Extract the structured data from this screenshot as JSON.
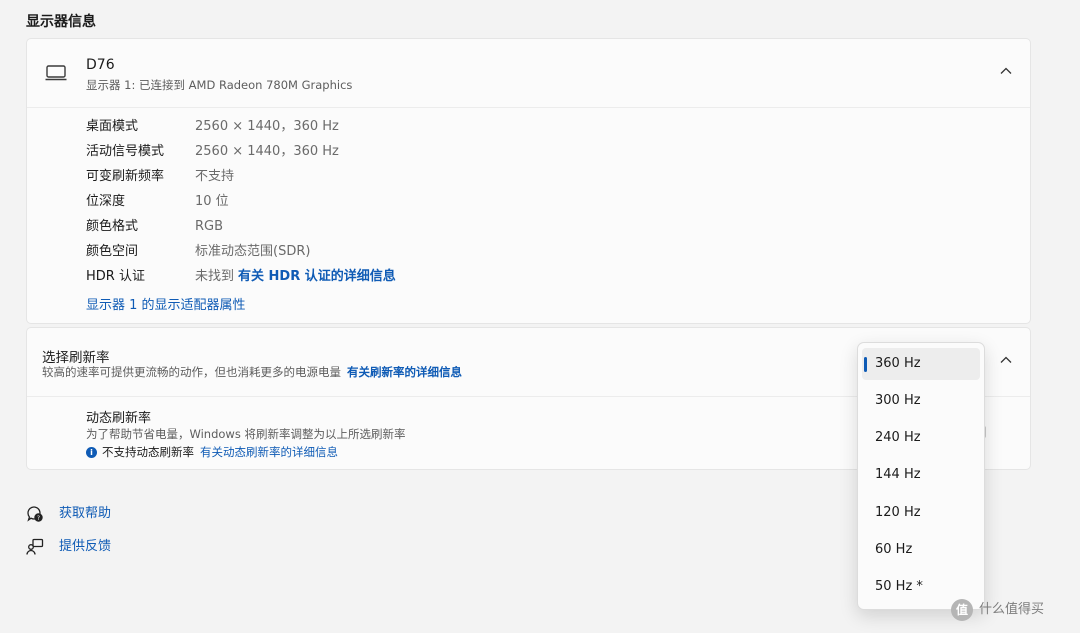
{
  "page": {
    "section_title": "显示器信息"
  },
  "display": {
    "name": "D76",
    "subtitle": "显示器 1: 已连接到 AMD Radeon 780M Graphics",
    "rows": [
      {
        "label": "桌面模式",
        "value": "2560 × 1440，360 Hz"
      },
      {
        "label": "活动信号模式",
        "value": "2560 × 1440，360 Hz"
      },
      {
        "label": "可变刷新频率",
        "value": "不支持"
      },
      {
        "label": "位深度",
        "value": "10 位"
      },
      {
        "label": "颜色格式",
        "value": "RGB"
      },
      {
        "label": "颜色空间",
        "value": "标准动态范围(SDR)"
      },
      {
        "label": "HDR 认证",
        "value": "未找到",
        "link": "有关 HDR 认证的详细信息"
      }
    ],
    "adapter_link": "显示器 1 的显示适配器属性"
  },
  "refresh_rate": {
    "title": "选择刷新率",
    "subtitle": "较高的速率可提供更流畅的动作，但也消耗更多的电源电量",
    "link": "有关刷新率的详细信息",
    "dynamic": {
      "title": "动态刷新率",
      "subtitle": "为了帮助节省电量，Windows 将刷新率调整为以上所选刷新率",
      "note": "不支持动态刷新率",
      "note_link": "有关动态刷新率的详细信息"
    },
    "options": [
      "360 Hz",
      "300 Hz",
      "240 Hz",
      "144 Hz",
      "120 Hz",
      "60 Hz",
      "50 Hz *"
    ],
    "selected": "360 Hz"
  },
  "footer": {
    "help": "获取帮助",
    "feedback": "提供反馈"
  },
  "watermark": {
    "text": "什么值得买",
    "icon_char": "值"
  },
  "colors": {
    "accent": "#0f5bb5",
    "background": "#f3f3f3",
    "card": "#fbfbfb"
  }
}
